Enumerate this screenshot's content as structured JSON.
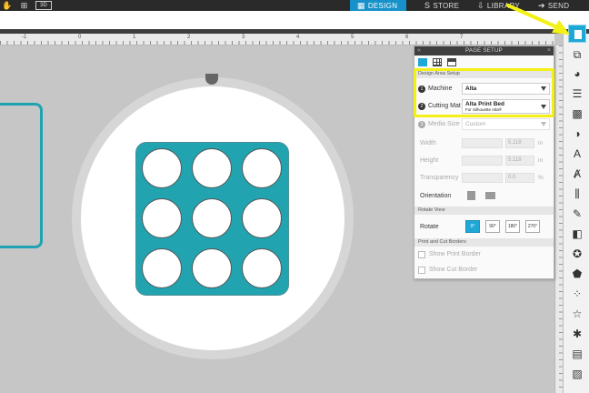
{
  "topbar": {
    "tools": [
      {
        "name": "hand",
        "glyph": "✋"
      },
      {
        "name": "add",
        "glyph": "⊞"
      },
      {
        "name": "3d",
        "glyph": "3D"
      }
    ],
    "tabs": [
      {
        "label": "DESIGN",
        "icon": "▦",
        "active": true
      },
      {
        "label": "STORE",
        "icon": "S"
      },
      {
        "label": "LIBRARY",
        "icon": "⇩"
      },
      {
        "label": "SEND",
        "icon": "➔"
      }
    ]
  },
  "ruler": {
    "labels": [
      "-1",
      "0",
      "1",
      "2",
      "3",
      "4",
      "5",
      "6",
      "7"
    ]
  },
  "page_setup": {
    "title": "PAGE SETUP",
    "collapse_glyph": "«",
    "close_glyph": "×",
    "sections": {
      "design_area": "Design Area Setup",
      "rotate_view": "Rotate View",
      "print_cut": "Print and Cut Borders"
    },
    "machine": {
      "badge": "1",
      "label": "Machine",
      "value": "Alta"
    },
    "cutting_mat": {
      "badge": "2",
      "label": "Cutting Mat",
      "value": "Alta Print Bed",
      "sub": "For Silhouette Alta®"
    },
    "media_size": {
      "badge": "3",
      "label": "Media Size",
      "value": "Custom"
    },
    "width": {
      "label": "Width",
      "value": "5.118",
      "unit": "in"
    },
    "height": {
      "label": "Height",
      "value": "5.118",
      "unit": "in"
    },
    "transparency": {
      "label": "Transparency",
      "value": "0.0",
      "unit": "%"
    },
    "orientation": {
      "label": "Orientation"
    },
    "rotate": {
      "label": "Rotate",
      "options": [
        "0°",
        "90°",
        "180°",
        "270°"
      ]
    },
    "show_print_border": "Show Print Border",
    "show_cut_border": "Show Cut Border"
  },
  "right_panel": {
    "icons": [
      "page-setup",
      "pixscan",
      "fill-color",
      "line-style",
      "gradient",
      "fill-pattern",
      "text",
      "text-style",
      "align",
      "replicate",
      "modify",
      "offset",
      "trace",
      "cut-settings",
      "sketch",
      "library-shapes",
      "store",
      "send"
    ]
  },
  "colors": {
    "accent": "#1fa8d6",
    "highlight": "#f3f016",
    "shape": "#22a3b0"
  }
}
